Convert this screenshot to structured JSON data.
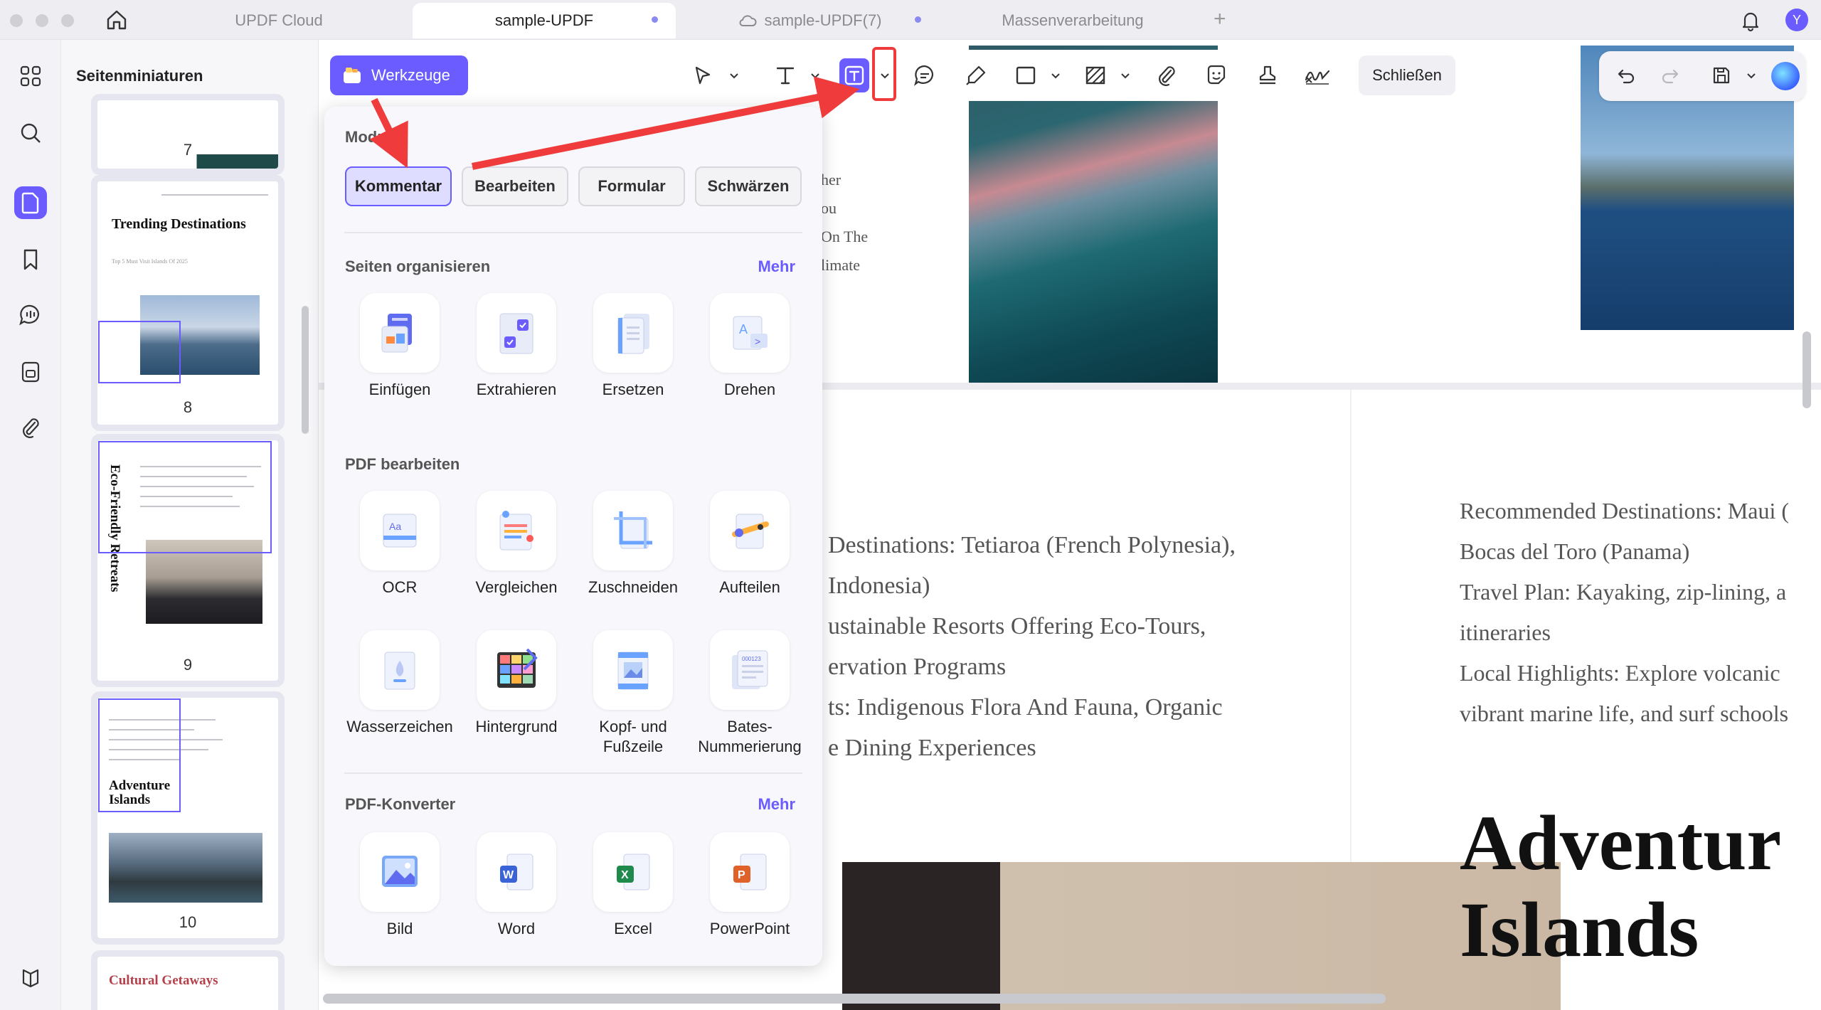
{
  "tabs": [
    {
      "label": "UPDF Cloud",
      "active": false
    },
    {
      "label": "sample-UPDF",
      "active": true
    },
    {
      "label": "sample-UPDF(7)",
      "active": false
    },
    {
      "label": "Massenverarbeitung",
      "active": false
    }
  ],
  "user": {
    "avatar_letter": "Y"
  },
  "thumbnails": {
    "title": "Seitenminiaturen",
    "pages": [
      {
        "number": "7"
      },
      {
        "number": "8",
        "heading": "Trending Destinations",
        "subtitle": "Top 5 Must Visit Islands Of 2025"
      },
      {
        "number": "9",
        "heading": "Eco-Friendly Retreats"
      },
      {
        "number": "10",
        "heading": "Adventure Islands"
      },
      {
        "heading": "Cultural Getaways"
      }
    ]
  },
  "toolbar": {
    "werkzeuge_label": "Werkzeuge",
    "close_label": "Schließen"
  },
  "panel": {
    "mode_title": "Modus",
    "modes": [
      {
        "label": "Kommentar",
        "active": true
      },
      {
        "label": "Bearbeiten",
        "active": false
      },
      {
        "label": "Formular",
        "active": false
      },
      {
        "label": "Schwärzen",
        "active": false
      }
    ],
    "sections": [
      {
        "title": "Seiten organisieren",
        "more": "Mehr",
        "items": [
          {
            "label": "Einfügen",
            "icon": "insert-icon"
          },
          {
            "label": "Extrahieren",
            "icon": "extract-icon"
          },
          {
            "label": "Ersetzen",
            "icon": "replace-icon"
          },
          {
            "label": "Drehen",
            "icon": "rotate-icon"
          }
        ]
      },
      {
        "title": "PDF bearbeiten",
        "items": [
          {
            "label": "OCR",
            "icon": "ocr-icon"
          },
          {
            "label": "Vergleichen",
            "icon": "compare-icon"
          },
          {
            "label": "Zuschneiden",
            "icon": "crop-icon"
          },
          {
            "label": "Aufteilen",
            "icon": "split-icon"
          },
          {
            "label": "Wasserzeichen",
            "icon": "watermark-icon"
          },
          {
            "label": "Hintergrund",
            "icon": "background-icon"
          },
          {
            "label": "Kopf- und Fußzeile",
            "icon": "header-footer-icon"
          },
          {
            "label": "Bates-Nummerierung",
            "icon": "bates-icon"
          }
        ]
      },
      {
        "title": "PDF-Konverter",
        "more": "Mehr",
        "items": [
          {
            "label": "Bild",
            "icon": "image-icon"
          },
          {
            "label": "Word",
            "icon": "word-icon"
          },
          {
            "label": "Excel",
            "icon": "excel-icon"
          },
          {
            "label": "PowerPoint",
            "icon": "powerpoint-icon"
          }
        ]
      }
    ]
  },
  "document": {
    "left_fragments": [
      "her",
      "ou",
      "On The",
      "limate"
    ],
    "middle_lines": [
      "Destinations: Tetiaroa (French Polynesia),",
      "Indonesia)",
      "ustainable Resorts Offering Eco-Tours,",
      "ervation Programs",
      "ts: Indigenous Flora And Fauna, Organic",
      "e Dining Experiences"
    ],
    "right_lines": [
      "Recommended Destinations: Maui (",
      "Bocas del Toro (Panama)",
      "Travel Plan: Kayaking, zip-lining, a",
      "itineraries",
      "Local Highlights: Explore volcanic",
      "vibrant marine life, and surf schools"
    ],
    "right_heading_1": "Adventur",
    "right_heading_2": "Islands"
  },
  "colors": {
    "accent": "#6a5cff",
    "highlight_red": "#ef3b3b",
    "annotation_arrow": "#ef3b3b"
  }
}
